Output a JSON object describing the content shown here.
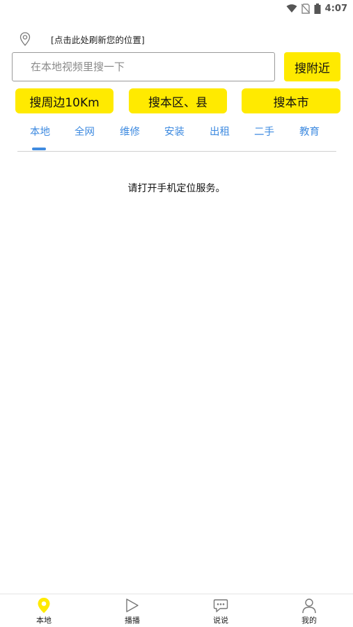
{
  "status_bar": {
    "time": "4:07",
    "icons": [
      "wifi-icon",
      "no-sim-icon",
      "battery-icon"
    ]
  },
  "location": {
    "icon": "location-pin-icon",
    "text": "[点击此处刷新您的位置]"
  },
  "search": {
    "placeholder": "在本地视频里搜一下",
    "value": "",
    "nearby_label": "搜附近"
  },
  "filters": {
    "km_label": "搜周边10Km",
    "district_label": "搜本区、县",
    "city_label": "搜本市"
  },
  "tabs": {
    "active": "本地",
    "items": [
      {
        "label": "本地"
      },
      {
        "label": "全网"
      },
      {
        "label": "维修"
      },
      {
        "label": "安装"
      },
      {
        "label": "出租"
      },
      {
        "label": "二手"
      },
      {
        "label": "教育"
      }
    ]
  },
  "message": "请打开手机定位服务。",
  "bottom_nav": {
    "items": [
      {
        "label": "本地",
        "icon": "location-pin-icon"
      },
      {
        "label": "播播",
        "icon": "play-icon"
      },
      {
        "label": "说说",
        "icon": "chat-icon"
      },
      {
        "label": "我的",
        "icon": "user-icon"
      }
    ]
  },
  "colors": {
    "accent": "#ffea00",
    "tab_text": "#3f8be0"
  }
}
